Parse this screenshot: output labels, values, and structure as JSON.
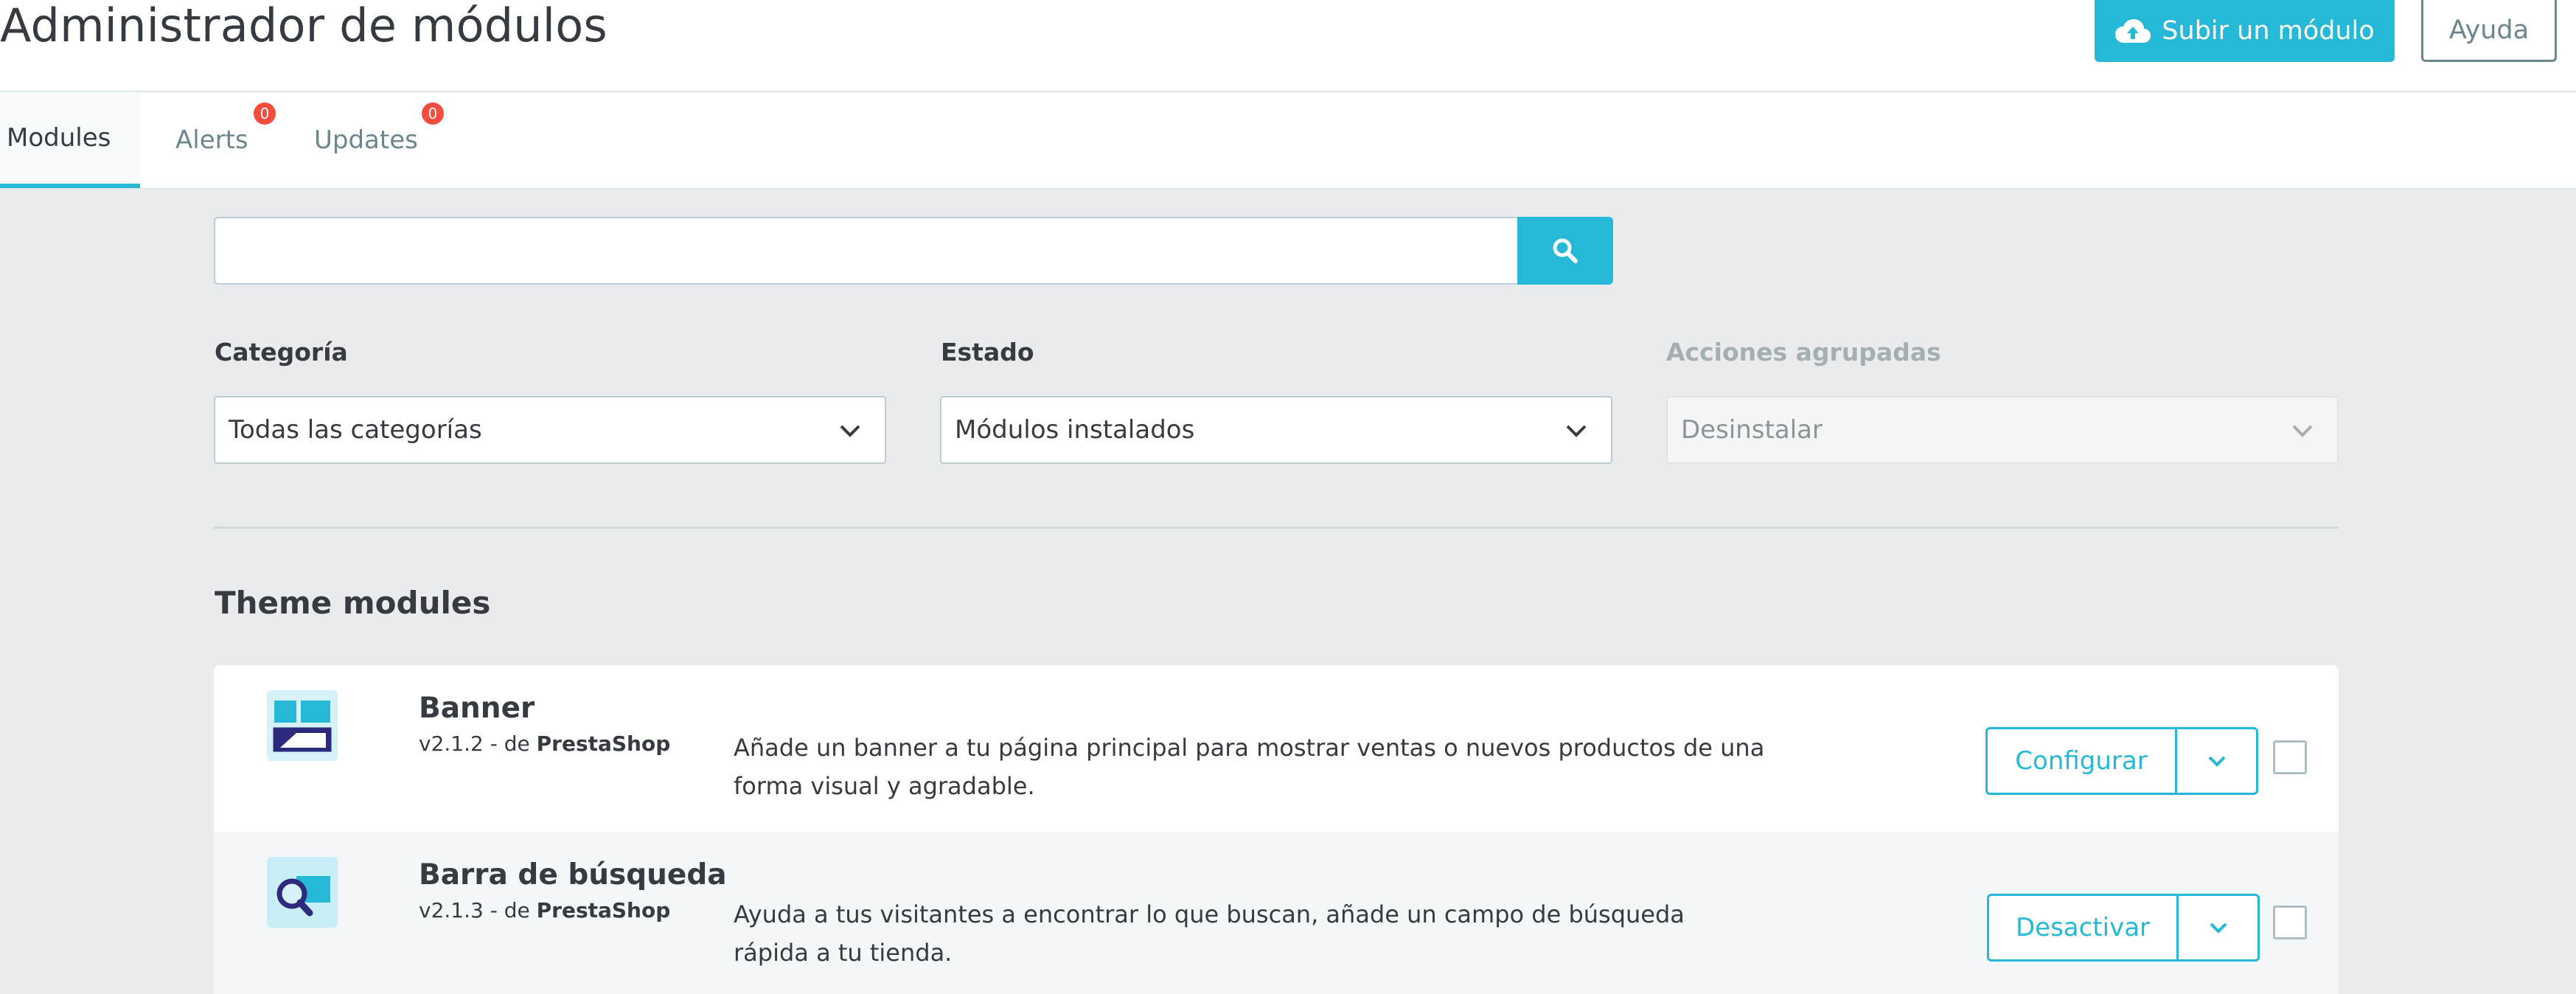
{
  "header": {
    "title": "Administrador de módulos",
    "upload_label": "Subir un módulo",
    "help_label": "Ayuda",
    "upload_icon": "cloud-upload-icon"
  },
  "tabs": [
    {
      "label": "Modules",
      "active": true
    },
    {
      "label": "Alerts",
      "badge": "0"
    },
    {
      "label": "Updates",
      "badge": "0"
    }
  ],
  "search": {
    "placeholder": "",
    "value": "",
    "icon": "search-icon"
  },
  "filters": {
    "category": {
      "label": "Categoría",
      "value": "Todas las categorías"
    },
    "status": {
      "label": "Estado",
      "value": "Módulos instalados"
    },
    "bulk": {
      "label": "Acciones agrupadas",
      "value": "Desinstalar",
      "disabled": true
    }
  },
  "section": {
    "title": "Theme modules"
  },
  "modules": [
    {
      "name": "Banner",
      "version": "v2.1.2 - de ",
      "author": "PrestaShop",
      "description": "Añade un banner a tu página principal para mostrar ventas o nuevos productos de una forma visual y agradable.",
      "action": "Configurar",
      "icon": "banner-module-icon"
    },
    {
      "name": "Barra de búsqueda",
      "version": "v2.1.3 - de ",
      "author": "PrestaShop",
      "description": "Ayuda a tus visitantes a encontrar lo que buscan, añade un campo de búsqueda rápida a tu tienda.",
      "action": "Desactivar",
      "icon": "search-bar-module-icon"
    }
  ],
  "colors": {
    "accent": "#25b9d7",
    "badge": "#f54c3e",
    "text": "#363a41",
    "muted": "#6c868e"
  }
}
